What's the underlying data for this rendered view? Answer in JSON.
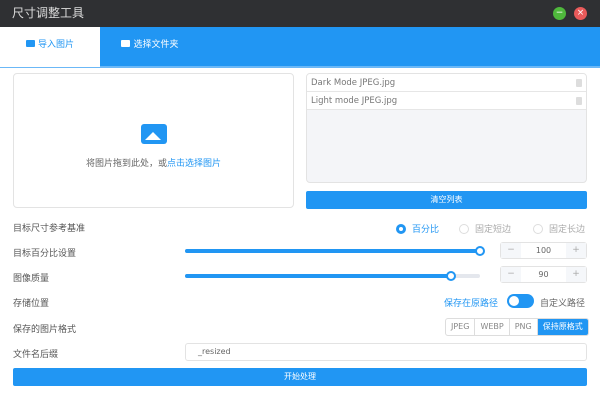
{
  "window": {
    "title": "尺寸调整工具"
  },
  "tabs": [
    {
      "label": "导入图片",
      "active": true
    },
    {
      "label": "选择文件夹",
      "active": false
    }
  ],
  "dropzone": {
    "text": "将图片拖到此处，或",
    "link": "点击选择图片"
  },
  "files": [
    "Dark Mode JPEG.jpg",
    "Light mode JPEG.jpg"
  ],
  "clear_label": "清空列表",
  "settings": {
    "basis_label": "目标尺寸参考基准",
    "basis_options": [
      "百分比",
      "固定短边",
      "固定长边"
    ],
    "basis_selected": "百分比",
    "percent_label": "目标百分比设置",
    "percent_value": "100",
    "percent_slider": 1.0,
    "quality_label": "图像质量",
    "quality_value": "90",
    "quality_slider": 0.9,
    "save_label": "存储位置",
    "save_left": "保存在原路径",
    "save_right": "自定义路径",
    "format_label": "保存的图片格式",
    "formats": [
      "JPEG",
      "WEBP",
      "PNG",
      "保持原格式"
    ],
    "format_selected": "保持原格式",
    "suffix_label": "文件名后缀",
    "suffix_value": "_resized",
    "minus": "−",
    "plus": "+"
  },
  "start_label": "开始处理",
  "colors": {
    "accent": "#2196f3",
    "titlebar": "#2f3033",
    "minimize": "#4fb83c",
    "close": "#e85a5a"
  }
}
